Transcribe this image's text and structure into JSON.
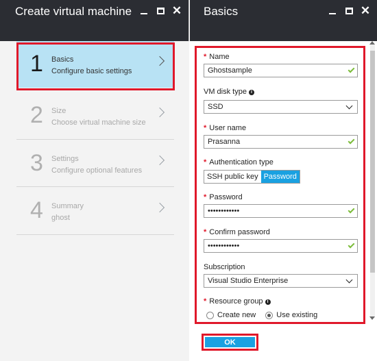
{
  "left_blade": {
    "title": "Create virtual machine",
    "steps": [
      {
        "number": "1",
        "title": "Basics",
        "subtitle": "Configure basic settings"
      },
      {
        "number": "2",
        "title": "Size",
        "subtitle": "Choose virtual machine size"
      },
      {
        "number": "3",
        "title": "Settings",
        "subtitle": "Configure optional features"
      },
      {
        "number": "4",
        "title": "Summary",
        "subtitle": "ghost"
      }
    ]
  },
  "right_blade": {
    "title": "Basics",
    "name_label": "Name",
    "name_value": "Ghostsample",
    "disk_label": "VM disk type",
    "disk_value": "SSD",
    "user_label": "User name",
    "user_value": "Prasanna",
    "auth_label": "Authentication type",
    "auth_options": [
      "SSH public key",
      "Password"
    ],
    "password_label": "Password",
    "password_value": "••••••••••••",
    "confirm_label": "Confirm password",
    "confirm_value": "••••••••••••",
    "subscription_label": "Subscription",
    "subscription_value": "Visual Studio Enterprise",
    "rg_label": "Resource group",
    "rg_options": [
      "Create new",
      "Use existing"
    ],
    "ok_label": "OK"
  },
  "colors": {
    "header_bg": "#2b2d33",
    "active_step_bg": "#b8e2f4",
    "accent": "#1aa1e1",
    "highlight_red": "#e0182a",
    "valid_check": "#7cbc3b"
  },
  "icons": {
    "minimize": "minimize-icon",
    "maximize": "maximize-icon",
    "close": "close-icon",
    "chevron": "chevron-right-icon",
    "check": "check-icon",
    "info": "info-icon"
  }
}
